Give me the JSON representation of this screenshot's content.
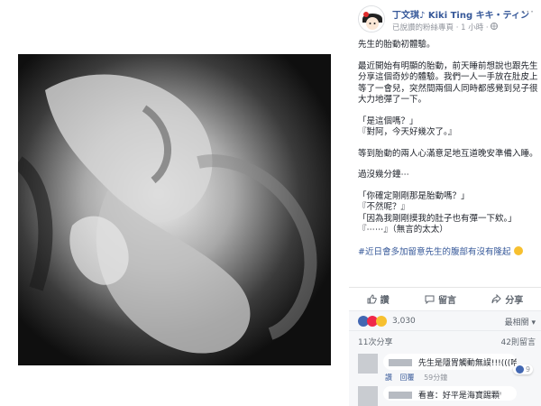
{
  "post": {
    "page_name": "丁文琪♪ Kiki Ting キキ・ティン",
    "meta_text": "已說讚的粉絲專頁 · 1 小時 ·",
    "more": "···",
    "paragraphs": {
      "p1": "先生的胎動初體驗。",
      "p2": [
        "最近開始有明顯的胎動，前天睡前想說也跟先生",
        "分享這個奇妙的體驗。我們一人一手放在肚皮上",
        "等了一會兒，突然間兩個人同時都感覺到兒子很",
        "大力地彈了一下。"
      ],
      "p3": [
        "「是這個嗎？」",
        "『對阿，今天好幾次了。』"
      ],
      "p4": "等到胎動的兩人心滿意足地互道晚安準備入睡。",
      "p5": "過沒幾分鐘⋯",
      "p6": [
        "「你確定剛剛那是胎動嗎？」",
        "『不然呢？』",
        "「因為我剛剛摸我的肚子也有彈一下欸。」",
        "『⋯⋯』（無言的太太）"
      ],
      "p7_hashtag": "#近日會多加留意先生的腹部有沒有隆起"
    }
  },
  "actions": {
    "like": "讚",
    "comment": "留言",
    "share": "分享"
  },
  "reactions": {
    "count": "3,030",
    "sort": "最相關 ▾"
  },
  "shares": {
    "count_text": "11次分享",
    "comments_text": "42則留言"
  },
  "comments": [
    {
      "text": "先生是隱胃觸動無誤!!!(((哈哈哈",
      "like": "讚",
      "reply": "回覆",
      "time": "59分鐘",
      "react_count": "9"
    },
    {
      "text": "看喜：好平是海寶踢顆ꜝ"
    }
  ],
  "colors": {
    "link": "#365899",
    "like_blue": "#4267b2",
    "love_red": "#f0284a",
    "haha_yellow": "#f7c02f"
  }
}
